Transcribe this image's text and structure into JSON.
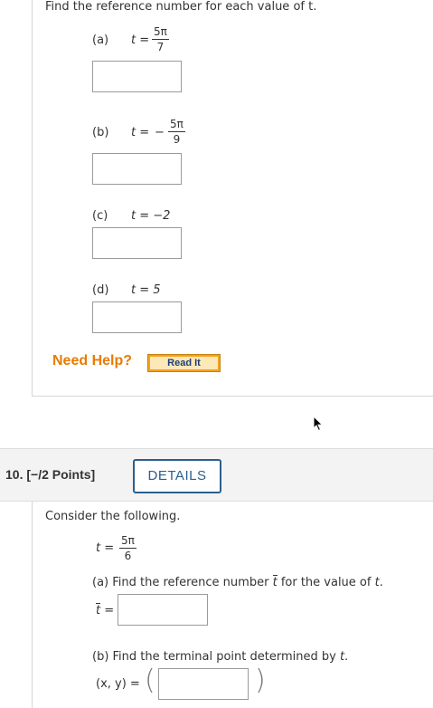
{
  "question9": {
    "prompt": "Find the reference number for each value of t.",
    "parts": [
      {
        "label": "(a)",
        "lhs": "t =",
        "sign": "",
        "num": "5π",
        "den": "7"
      },
      {
        "label": "(b)",
        "lhs": "t =",
        "sign": "−",
        "num": "5π",
        "den": "9"
      },
      {
        "label": "(c)",
        "lhs": "t = −2"
      },
      {
        "label": "(d)",
        "lhs": "t = 5"
      }
    ],
    "need_help": "Need Help?",
    "read_it": "Read It"
  },
  "question10": {
    "number": "10.",
    "points": "[−/2 Points]",
    "details": "DETAILS",
    "intro": "Consider the following.",
    "t_lhs": "t =",
    "t_num": "5π",
    "t_den": "6",
    "part_a_text": "(a) Find the reference number",
    "part_a_tbar": "t",
    "part_a_tail": "for the value of",
    "part_a_t": "t",
    "tbar_label": "t",
    "tbar_eq": "=",
    "part_b_text": "(b) Find the terminal point determined by",
    "part_b_t": "t",
    "xy_label": "(x, y) ="
  },
  "colors": {
    "need_help": "#e87b00",
    "details": "#2b5f8e",
    "read_it_bg": "#f4a21c"
  },
  "icons": [
    "mouse-cursor-icon"
  ]
}
